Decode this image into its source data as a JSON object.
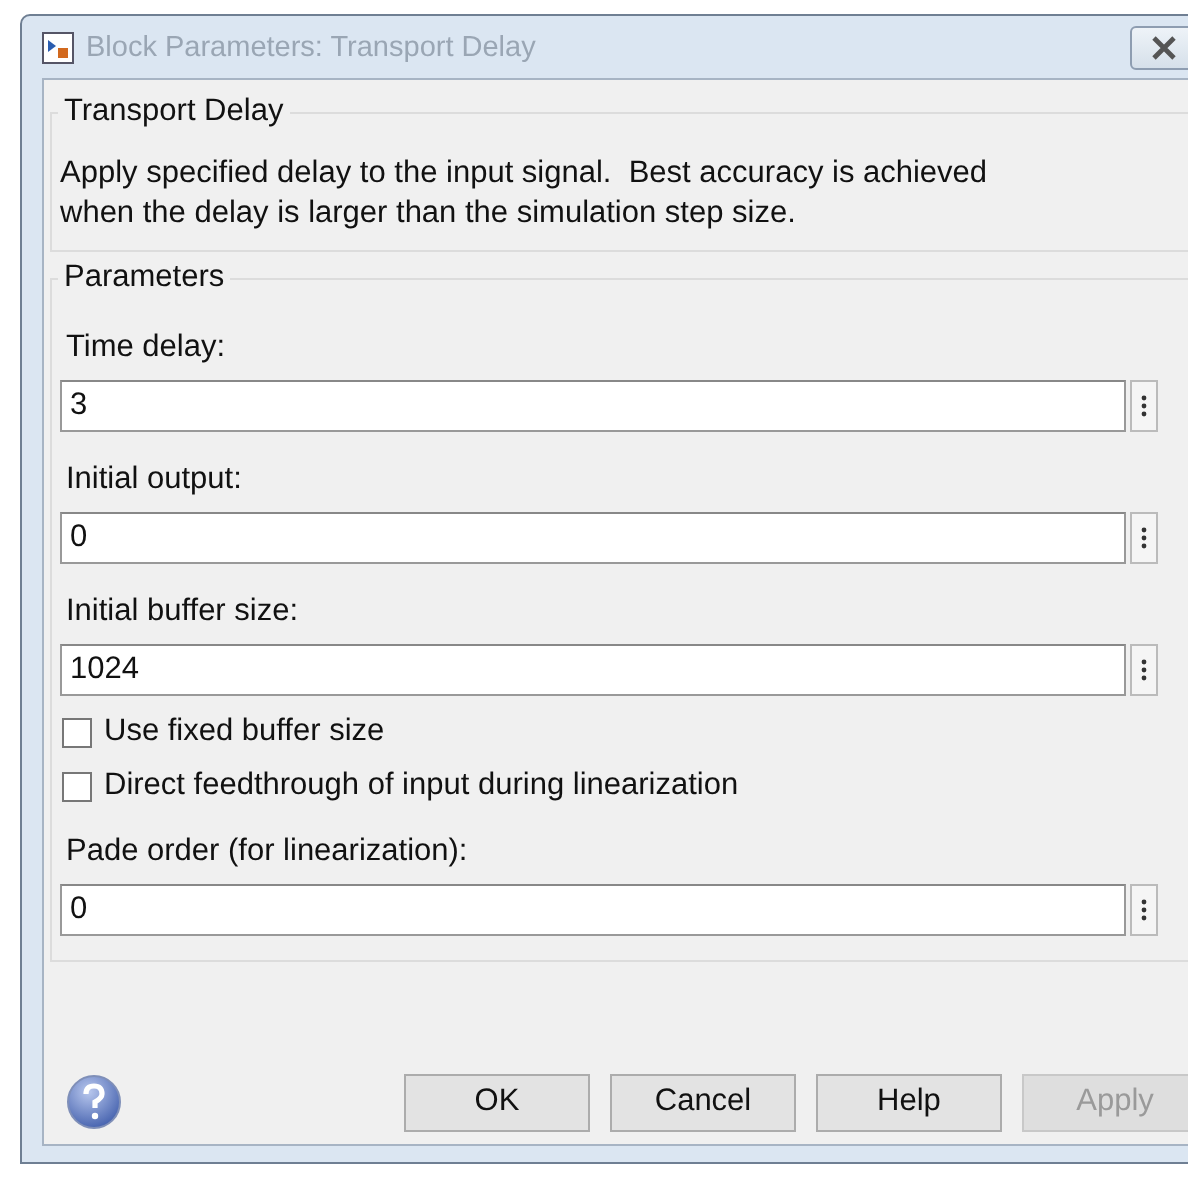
{
  "window": {
    "title": "Block Parameters: Transport Delay"
  },
  "description_group": {
    "title": "Transport Delay",
    "text": "Apply specified delay to the input signal.  Best accuracy is achieved when the delay is larger than the simulation step size."
  },
  "parameters_group": {
    "title": "Parameters",
    "items": [
      {
        "kind": "field",
        "label": "Time delay:",
        "value": "3"
      },
      {
        "kind": "field",
        "label": "Initial output:",
        "value": "0"
      },
      {
        "kind": "field",
        "label": "Initial buffer size:",
        "value": "1024"
      },
      {
        "kind": "checkbox",
        "label": "Use fixed buffer size",
        "checked": false
      },
      {
        "kind": "checkbox",
        "label": "Direct feedthrough of input during linearization",
        "checked": false
      },
      {
        "kind": "field",
        "label": "Pade order (for linearization):",
        "value": "0"
      }
    ]
  },
  "buttons": [
    {
      "label": "OK",
      "disabled": false
    },
    {
      "label": "Cancel",
      "disabled": false
    },
    {
      "label": "Help",
      "disabled": false
    },
    {
      "label": "Apply",
      "disabled": true
    }
  ]
}
